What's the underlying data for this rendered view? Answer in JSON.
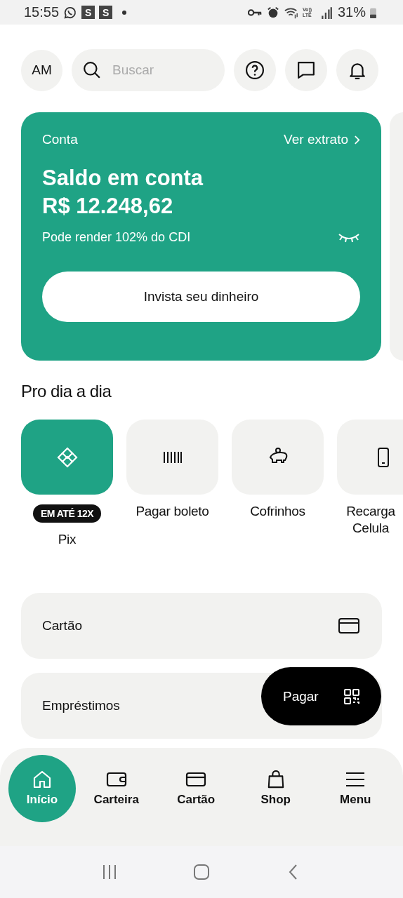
{
  "status_bar": {
    "time": "15:55",
    "badges": [
      "S",
      "S"
    ],
    "network": "Vo)) LTE",
    "battery": "31%"
  },
  "header": {
    "avatar": "AM",
    "search": {
      "placeholder": "Buscar"
    }
  },
  "account_card": {
    "label": "Conta",
    "link": "Ver extrato",
    "title": "Saldo em conta",
    "balance": "R$ 12.248,62",
    "subtitle": "Pode render 102% do CDI",
    "button": "Invista seu dinheiro"
  },
  "section_title": "Pro dia a dia",
  "shortcuts": [
    {
      "kind": "pix",
      "label": "Pix",
      "badge": "EM ATÉ 12X",
      "selected": true
    },
    {
      "kind": "boleto",
      "label": "Pagar boleto",
      "selected": false
    },
    {
      "kind": "piggy",
      "label": "Cofrinhos",
      "selected": false
    },
    {
      "kind": "phone",
      "label": "Recarga Celula",
      "selected": false
    }
  ],
  "list": [
    {
      "kind": "card",
      "label": "Cartão"
    },
    {
      "kind": "none",
      "label": "Empréstimos"
    }
  ],
  "pay_button": {
    "label": "Pagar"
  },
  "bottom_nav": [
    {
      "kind": "home",
      "label": "Início",
      "selected": true
    },
    {
      "kind": "wallet",
      "label": "Carteira",
      "selected": false
    },
    {
      "kind": "card",
      "label": "Cartão",
      "selected": false
    },
    {
      "kind": "bag",
      "label": "Shop",
      "selected": false
    },
    {
      "kind": "menu",
      "label": "Menu",
      "selected": false
    }
  ]
}
